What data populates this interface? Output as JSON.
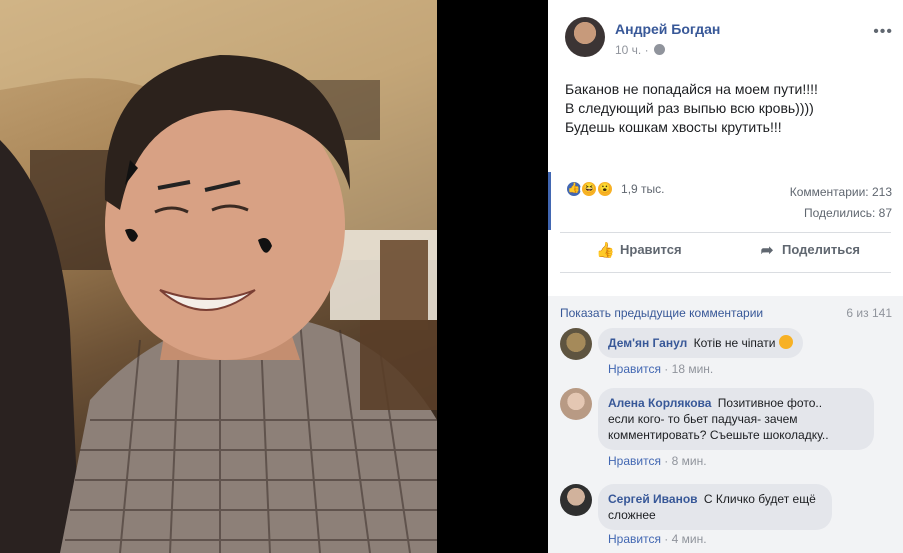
{
  "post": {
    "author": "Андрей Богдан",
    "time": "10 ч.",
    "text_lines": [
      "Баканов не попадайся на моем пути!!!!",
      "В следующий раз выпью всю кровь))))",
      "Будешь кошкам хвосты крутить!!!"
    ],
    "reactions_count": "1,9 тыс.",
    "comments_stat": "Комментарии: 213",
    "shares_stat": "Поделились: 87",
    "like_label": "Нравится",
    "share_label": "Поделиться",
    "more_icon": "more-horizontal-icon"
  },
  "comments_section": {
    "show_previous": "Показать предыдущие комментарии",
    "counter": "6 из 141",
    "items": [
      {
        "name": "Дем'ян Ганул",
        "text": "Котів не чіпати",
        "like": "Нравится",
        "time": "18 мин."
      },
      {
        "name": "Алена Корлякова",
        "text_lines": [
          "Позитивное фото..",
          "если кого- то бьет падучая- зачем",
          "комментировать? Съешьте шоколадку.."
        ],
        "like": "Нравится",
        "time": "8 мин."
      },
      {
        "name": "Сергей Иванов",
        "text_lines": [
          "С Кличко будет ещё",
          "сложнее"
        ],
        "like": "Нравится",
        "time": "4 мин."
      }
    ]
  },
  "colors": {
    "link_blue": "#385898",
    "like_blue": "#4267b2",
    "muted": "#90949c",
    "comments_bg": "#f2f3f5"
  }
}
